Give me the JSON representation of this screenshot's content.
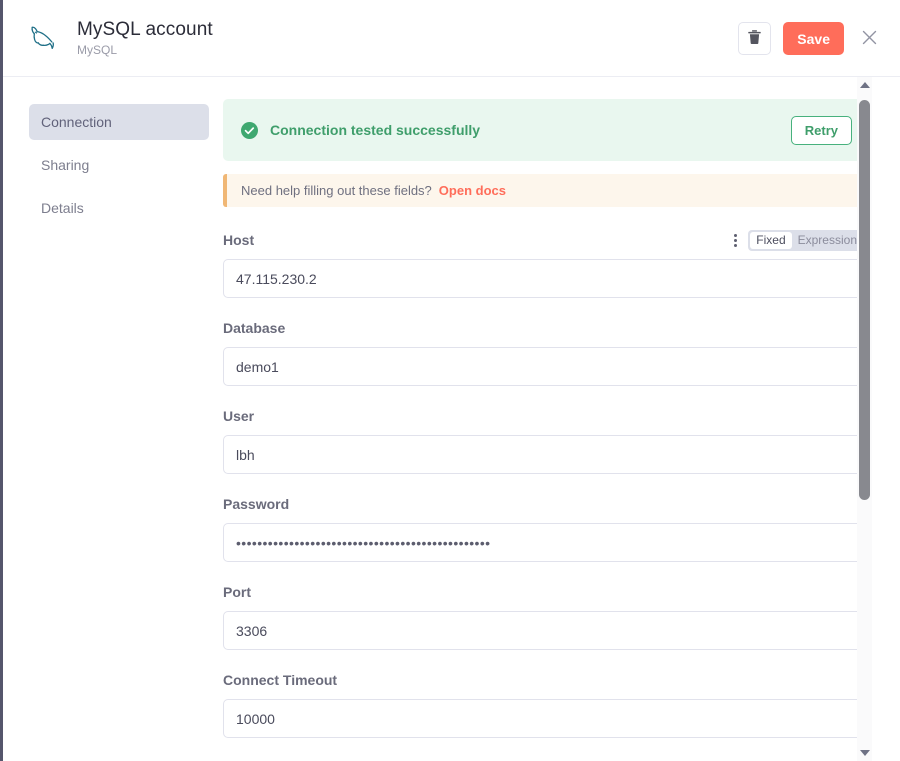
{
  "header": {
    "logo_icon": "mysql-dolphin-icon",
    "title": "MySQL account",
    "subtitle": "MySQL",
    "delete_icon": "trash-icon",
    "save_label": "Save",
    "close_icon": "close-icon"
  },
  "sidebar": {
    "items": [
      {
        "label": "Connection",
        "active": true
      },
      {
        "label": "Sharing",
        "active": false
      },
      {
        "label": "Details",
        "active": false
      }
    ]
  },
  "status_banner": {
    "icon": "check-circle-icon",
    "text": "Connection tested successfully",
    "retry_label": "Retry"
  },
  "help_banner": {
    "text": "Need help filling out these fields?",
    "link_label": "Open docs"
  },
  "form": {
    "fields": [
      {
        "label": "Host",
        "value": "47.115.230.2",
        "type": "text",
        "has_options": true
      },
      {
        "label": "Database",
        "value": "demo1",
        "type": "text",
        "has_options": false
      },
      {
        "label": "User",
        "value": "lbh",
        "type": "text",
        "has_options": false
      },
      {
        "label": "Password",
        "value": "••••••••••••••••••••••••••••••••••••••••••••••••",
        "type": "password",
        "has_options": false
      },
      {
        "label": "Port",
        "value": "3306",
        "type": "text",
        "has_options": false
      },
      {
        "label": "Connect Timeout",
        "value": "10000",
        "type": "text",
        "has_options": false
      }
    ],
    "param_options": {
      "kebab_icon": "kebab-menu-icon",
      "fixed_label": "Fixed",
      "expression_label": "Expression",
      "selected_mode": "Fixed"
    }
  },
  "scrollbar": {
    "up_icon": "scroll-up-arrow-icon",
    "down_icon": "scroll-down-arrow-icon"
  },
  "colors": {
    "accent": "#ff6d5a",
    "success": "#3f9e6b",
    "success_bg": "#e9f7ef",
    "help_bg": "#fdf6ec",
    "help_border": "#f0b775",
    "sidebar_active_bg": "#dcdfe9",
    "mysql_teal": "#1f6f87"
  }
}
